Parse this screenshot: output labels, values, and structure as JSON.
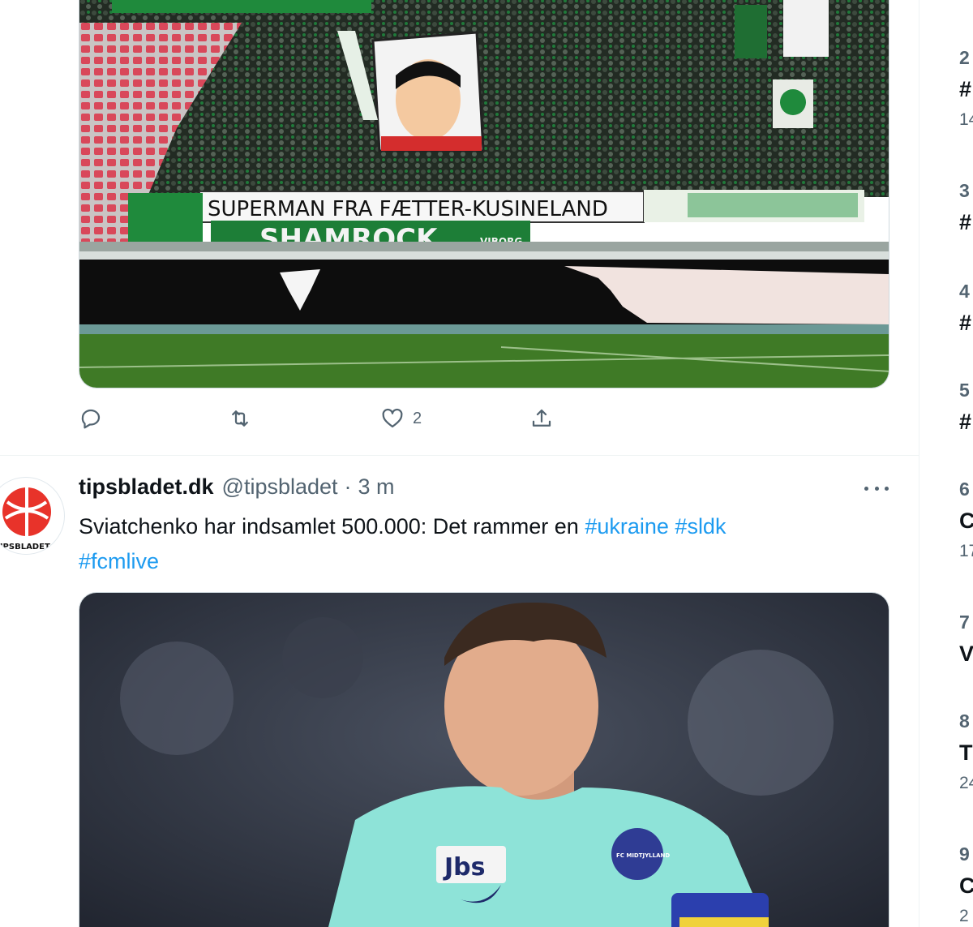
{
  "tweet1": {
    "banner_text": "SUPERMAN FRA FÆTTER-KUSINELAND",
    "sign_text": "SHAMROCK",
    "sign_sub": "VIBORG",
    "actions": {
      "reply_icon": "reply-icon",
      "retweet_icon": "retweet-icon",
      "like_icon": "heart-icon",
      "like_count": "2",
      "share_icon": "share-icon"
    }
  },
  "tweet2": {
    "avatar_text": "TIPSBLADET",
    "display_name": "tipsbladet.dk",
    "handle": "@tipsbladet",
    "separator": "·",
    "time": "3 m",
    "text_prefix": "Sviatchenko har indsamlet 500.000: Det rammer en ",
    "hashtags": [
      "#ukraine",
      "#sldk",
      "#fcmlive"
    ],
    "jersey_sponsor": "Jbs",
    "badge_text": "FC MIDTJYLLAND"
  },
  "sidebar": {
    "trends": [
      {
        "rank": "2",
        "title": "#",
        "sub": "14"
      },
      {
        "rank": "3",
        "title": "#",
        "sub": ""
      },
      {
        "rank": "4",
        "title": "#",
        "sub": ""
      },
      {
        "rank": "5",
        "title": "#",
        "sub": ""
      },
      {
        "rank": "6",
        "title": "C",
        "sub": "17"
      },
      {
        "rank": "7",
        "title": "V",
        "sub": ""
      },
      {
        "rank": "8",
        "title": "T",
        "sub": "24"
      },
      {
        "rank": "9",
        "title": "C",
        "sub": "2"
      }
    ]
  },
  "colors": {
    "link": "#1d9bf0",
    "secondary": "#536471",
    "pitch": "#3f7a26",
    "fan_green": "#1f8a3c"
  }
}
